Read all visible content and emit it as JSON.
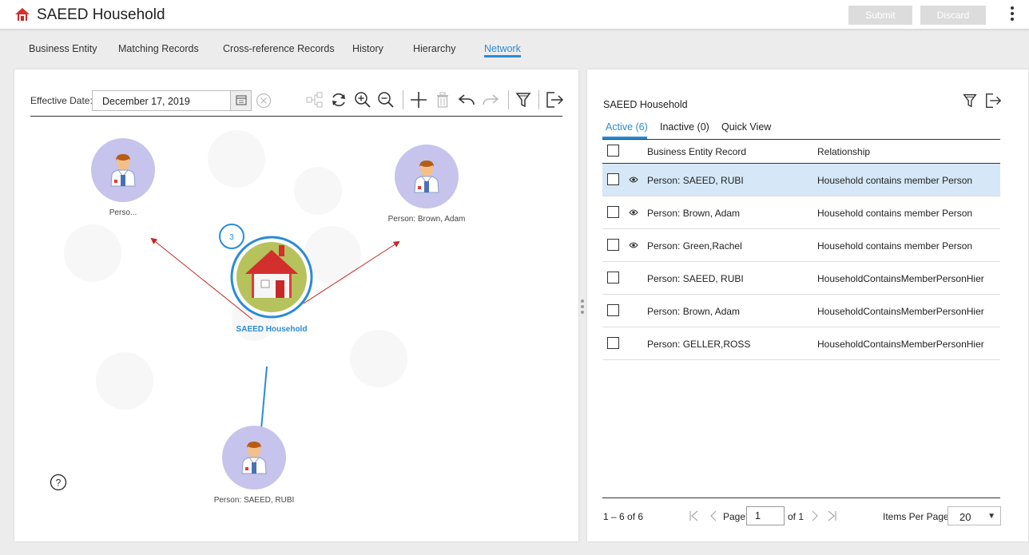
{
  "header": {
    "title": "SAEED Household",
    "submit_label": "Submit",
    "discard_label": "Discard"
  },
  "tabs": [
    {
      "label": "Business Entity"
    },
    {
      "label": "Matching Records"
    },
    {
      "label": "Cross-reference Records"
    },
    {
      "label": "History"
    },
    {
      "label": "Hierarchy"
    },
    {
      "label": "Network"
    }
  ],
  "active_tab": "Network",
  "left_panel": {
    "effective_date_label": "Effective Date:",
    "effective_date_value": "December 17, 2019",
    "toolbar_icons": [
      "layout-icon",
      "refresh-icon",
      "zoom-in-icon",
      "zoom-out-icon",
      "add-icon",
      "delete-icon",
      "undo-icon",
      "redo-icon",
      "filter-icon",
      "export-icon"
    ]
  },
  "graph": {
    "center": {
      "label": "SAEED Household",
      "badge": "3"
    },
    "nodes": [
      {
        "label": "Perso..."
      },
      {
        "label": "Person: Brown, Adam"
      },
      {
        "label": "Person: SAEED, RUBI"
      }
    ]
  },
  "right_panel": {
    "title": "SAEED Household",
    "subtabs": [
      {
        "label": "Active (6)"
      },
      {
        "label": "Inactive (0)"
      },
      {
        "label": "Quick View"
      }
    ],
    "columns": {
      "record": "Business Entity Record",
      "relationship": "Relationship"
    },
    "rows": [
      {
        "record": "Person: SAEED, RUBI",
        "relationship": "Household contains member Person"
      },
      {
        "record": "Person: Brown, Adam",
        "relationship": "Household contains member Person"
      },
      {
        "record": "Person: Green,Rachel",
        "relationship": "Household contains member Person"
      },
      {
        "record": "Person: SAEED, RUBI",
        "relationship": "HouseholdContainsMemberPersonHier"
      },
      {
        "record": "Person: Brown, Adam",
        "relationship": "HouseholdContainsMemberPersonHier"
      },
      {
        "record": "Person: GELLER,ROSS",
        "relationship": "HouseholdContainsMemberPersonHier"
      }
    ],
    "pager": {
      "count": "1 – 6 of 6",
      "page_label": "Page",
      "page_value": "1",
      "of_label": "of 1",
      "items_per_page_label": "Items Per Page:",
      "items_per_page_value": "20"
    }
  },
  "colors": {
    "accent": "#2b8bd6",
    "selected_row": "#d6e8f7",
    "edge_red": "#c62828",
    "node_fill": "#c6c3ec",
    "center_fill": "#b6c25c"
  }
}
